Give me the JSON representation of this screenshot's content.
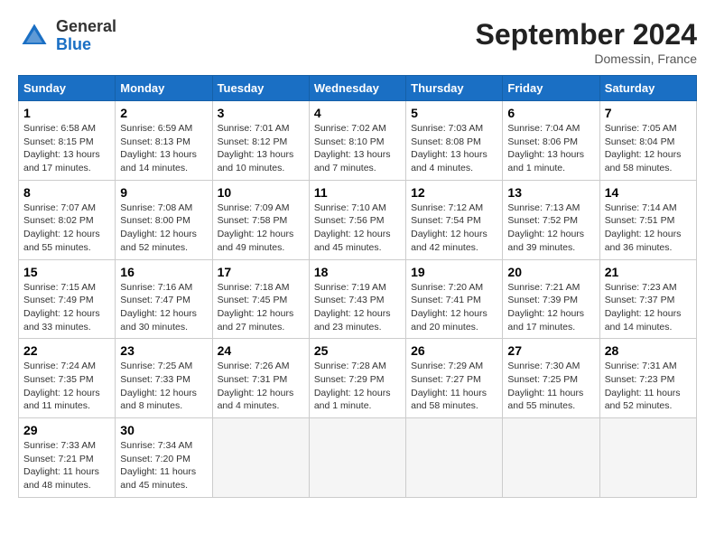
{
  "header": {
    "logo": {
      "general": "General",
      "blue": "Blue"
    },
    "title": "September 2024",
    "location": "Domessin, France"
  },
  "calendar": {
    "days_of_week": [
      "Sunday",
      "Monday",
      "Tuesday",
      "Wednesday",
      "Thursday",
      "Friday",
      "Saturday"
    ],
    "weeks": [
      [
        {
          "day": null,
          "info": ""
        },
        {
          "day": null,
          "info": ""
        },
        {
          "day": null,
          "info": ""
        },
        {
          "day": null,
          "info": ""
        },
        {
          "day": null,
          "info": ""
        },
        {
          "day": null,
          "info": ""
        },
        {
          "day": null,
          "info": ""
        }
      ],
      [
        {
          "day": "1",
          "info": "Sunrise: 6:58 AM\nSunset: 8:15 PM\nDaylight: 13 hours and 17 minutes."
        },
        {
          "day": "2",
          "info": "Sunrise: 6:59 AM\nSunset: 8:13 PM\nDaylight: 13 hours and 14 minutes."
        },
        {
          "day": "3",
          "info": "Sunrise: 7:01 AM\nSunset: 8:12 PM\nDaylight: 13 hours and 10 minutes."
        },
        {
          "day": "4",
          "info": "Sunrise: 7:02 AM\nSunset: 8:10 PM\nDaylight: 13 hours and 7 minutes."
        },
        {
          "day": "5",
          "info": "Sunrise: 7:03 AM\nSunset: 8:08 PM\nDaylight: 13 hours and 4 minutes."
        },
        {
          "day": "6",
          "info": "Sunrise: 7:04 AM\nSunset: 8:06 PM\nDaylight: 13 hours and 1 minute."
        },
        {
          "day": "7",
          "info": "Sunrise: 7:05 AM\nSunset: 8:04 PM\nDaylight: 12 hours and 58 minutes."
        }
      ],
      [
        {
          "day": "8",
          "info": "Sunrise: 7:07 AM\nSunset: 8:02 PM\nDaylight: 12 hours and 55 minutes."
        },
        {
          "day": "9",
          "info": "Sunrise: 7:08 AM\nSunset: 8:00 PM\nDaylight: 12 hours and 52 minutes."
        },
        {
          "day": "10",
          "info": "Sunrise: 7:09 AM\nSunset: 7:58 PM\nDaylight: 12 hours and 49 minutes."
        },
        {
          "day": "11",
          "info": "Sunrise: 7:10 AM\nSunset: 7:56 PM\nDaylight: 12 hours and 45 minutes."
        },
        {
          "day": "12",
          "info": "Sunrise: 7:12 AM\nSunset: 7:54 PM\nDaylight: 12 hours and 42 minutes."
        },
        {
          "day": "13",
          "info": "Sunrise: 7:13 AM\nSunset: 7:52 PM\nDaylight: 12 hours and 39 minutes."
        },
        {
          "day": "14",
          "info": "Sunrise: 7:14 AM\nSunset: 7:51 PM\nDaylight: 12 hours and 36 minutes."
        }
      ],
      [
        {
          "day": "15",
          "info": "Sunrise: 7:15 AM\nSunset: 7:49 PM\nDaylight: 12 hours and 33 minutes."
        },
        {
          "day": "16",
          "info": "Sunrise: 7:16 AM\nSunset: 7:47 PM\nDaylight: 12 hours and 30 minutes."
        },
        {
          "day": "17",
          "info": "Sunrise: 7:18 AM\nSunset: 7:45 PM\nDaylight: 12 hours and 27 minutes."
        },
        {
          "day": "18",
          "info": "Sunrise: 7:19 AM\nSunset: 7:43 PM\nDaylight: 12 hours and 23 minutes."
        },
        {
          "day": "19",
          "info": "Sunrise: 7:20 AM\nSunset: 7:41 PM\nDaylight: 12 hours and 20 minutes."
        },
        {
          "day": "20",
          "info": "Sunrise: 7:21 AM\nSunset: 7:39 PM\nDaylight: 12 hours and 17 minutes."
        },
        {
          "day": "21",
          "info": "Sunrise: 7:23 AM\nSunset: 7:37 PM\nDaylight: 12 hours and 14 minutes."
        }
      ],
      [
        {
          "day": "22",
          "info": "Sunrise: 7:24 AM\nSunset: 7:35 PM\nDaylight: 12 hours and 11 minutes."
        },
        {
          "day": "23",
          "info": "Sunrise: 7:25 AM\nSunset: 7:33 PM\nDaylight: 12 hours and 8 minutes."
        },
        {
          "day": "24",
          "info": "Sunrise: 7:26 AM\nSunset: 7:31 PM\nDaylight: 12 hours and 4 minutes."
        },
        {
          "day": "25",
          "info": "Sunrise: 7:28 AM\nSunset: 7:29 PM\nDaylight: 12 hours and 1 minute."
        },
        {
          "day": "26",
          "info": "Sunrise: 7:29 AM\nSunset: 7:27 PM\nDaylight: 11 hours and 58 minutes."
        },
        {
          "day": "27",
          "info": "Sunrise: 7:30 AM\nSunset: 7:25 PM\nDaylight: 11 hours and 55 minutes."
        },
        {
          "day": "28",
          "info": "Sunrise: 7:31 AM\nSunset: 7:23 PM\nDaylight: 11 hours and 52 minutes."
        }
      ],
      [
        {
          "day": "29",
          "info": "Sunrise: 7:33 AM\nSunset: 7:21 PM\nDaylight: 11 hours and 48 minutes."
        },
        {
          "day": "30",
          "info": "Sunrise: 7:34 AM\nSunset: 7:20 PM\nDaylight: 11 hours and 45 minutes."
        },
        {
          "day": null,
          "info": ""
        },
        {
          "day": null,
          "info": ""
        },
        {
          "day": null,
          "info": ""
        },
        {
          "day": null,
          "info": ""
        },
        {
          "day": null,
          "info": ""
        }
      ]
    ]
  }
}
